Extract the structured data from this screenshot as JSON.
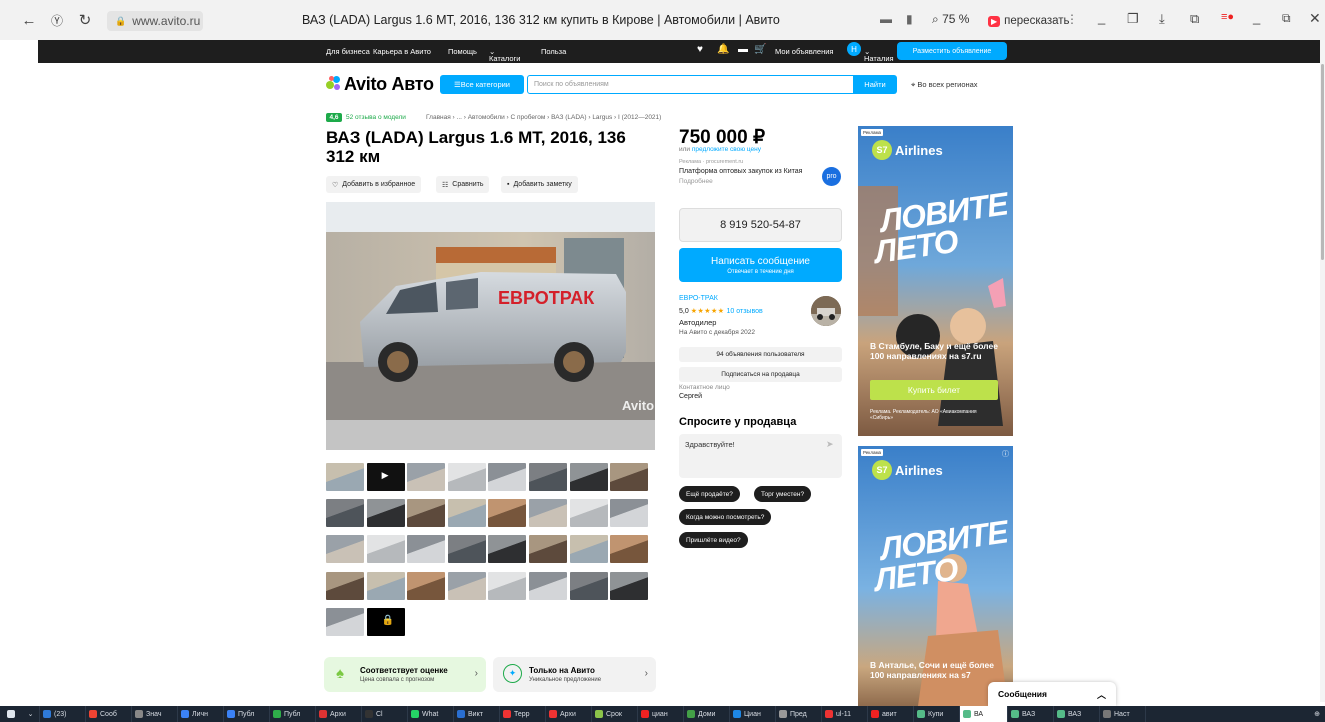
{
  "browser": {
    "url": "www.avito.ru",
    "tab_title": "ВАЗ (LADA) Largus 1.6 MT, 2016, 136 312 км купить в Кирове | Автомобили | Авито",
    "zoom": "75 %",
    "retell_label": "пересказать"
  },
  "topnav": {
    "links": [
      "Для бизнеса",
      "Карьера в Авито",
      "Помощь",
      "Каталоги",
      "Польза"
    ],
    "my_ads": "Мои объявления",
    "user_initial": "Н",
    "user_name": "Наталия",
    "post_ad": "Разместить объявление"
  },
  "header": {
    "logo": "Avito Авто",
    "categories_button": "Все категории",
    "search_placeholder": "Поиск по объявлениям",
    "find_button": "Найти",
    "region": "Во всех регионах"
  },
  "listing": {
    "model_rating": "4,6",
    "model_reviews": "52 отзыва о модели",
    "breadcrumb": "Главная › ... › Автомобили › С пробегом › ВАЗ (LADA) › Largus › I (2012—2021)",
    "title": "ВАЗ (LADA) Largus 1.6 MT, 2016, 136 312 км",
    "actions": [
      "Добавить в избранное",
      "Сравнить",
      "Добавить заметку"
    ],
    "photo_brand": "ЕВРОТРАК",
    "photo_watermark": "Avito",
    "thumbnail_count": 34,
    "badges": [
      {
        "title": "Соответствует оценке",
        "subtitle": "Цена совпала с прогнозом"
      },
      {
        "title": "Только на Авито",
        "subtitle": "Уникальное предложение"
      }
    ]
  },
  "sidebar": {
    "price": "750 000 ₽",
    "offer_prefix": "или",
    "offer_link": "предложите свою цену",
    "ad_label": "Реклама · procurement.ru",
    "ad_text": "Платформа оптовых закупок из Китая",
    "ad_more": "Подробнее",
    "ad_badge": "pro",
    "phone": "8 919 520-54-87",
    "message_button": "Написать сообщение",
    "message_sub": "Отвечает в течение дня",
    "seller_name": "ЕВРО-ТРАК",
    "seller_rating": "5,0",
    "seller_stars": "★★★★★",
    "seller_reviews": "10 отзывов",
    "seller_type": "Автодилер",
    "seller_since": "На Авито с декабря 2022",
    "user_ads": "94 объявления пользователя",
    "subscribe": "Подписаться на продавца",
    "contact_label": "Контактное лицо",
    "contact_name": "Сергей",
    "ask_title": "Спросите у продавца",
    "ask_placeholder": "Здравствуйте!",
    "quick_questions": [
      "Ещё продаёте?",
      "Торг уместен?",
      "Когда можно посмотреть?",
      "Пришлёте видео?"
    ]
  },
  "banners": [
    {
      "ad_tag": "Реклама",
      "brand": "Airlines",
      "headline_1": "ЛОВИТЕ",
      "headline_2": "ЛЕТО",
      "sub": "В Стамбуле, Баку и ещё более 100 направлениях на s7.ru",
      "cta": "Купить билет",
      "fine": "Реклама. Рекламодатель: АО «Авиакомпания «Сибирь»"
    },
    {
      "ad_tag": "Реклама",
      "brand": "Airlines",
      "headline_1": "ЛОВИТЕ",
      "headline_2": "ЛЕТО",
      "sub": "В Анталье, Сочи и ещё более 100 направлениях на s7"
    }
  ],
  "messages_widget": "Сообщения",
  "taskbar": [
    "(23)",
    "Сооб",
    "Знач",
    "Личн",
    "Публ",
    "Публ",
    "Архи",
    "Cl",
    "What",
    "Викт",
    "Терр",
    "Архи",
    "Срок",
    "циан",
    "Доми",
    "Циан",
    "Пред",
    "ul-11",
    "авит",
    "Купи",
    "ВА",
    "ВАЗ",
    "ВАЗ",
    "Наст"
  ],
  "colors": {
    "accent": "#00aaff",
    "green": "#1daa4a",
    "dark": "#1e1e1e",
    "s7_lime": "#bde14b",
    "banner_sky": "#3a7fc9"
  }
}
